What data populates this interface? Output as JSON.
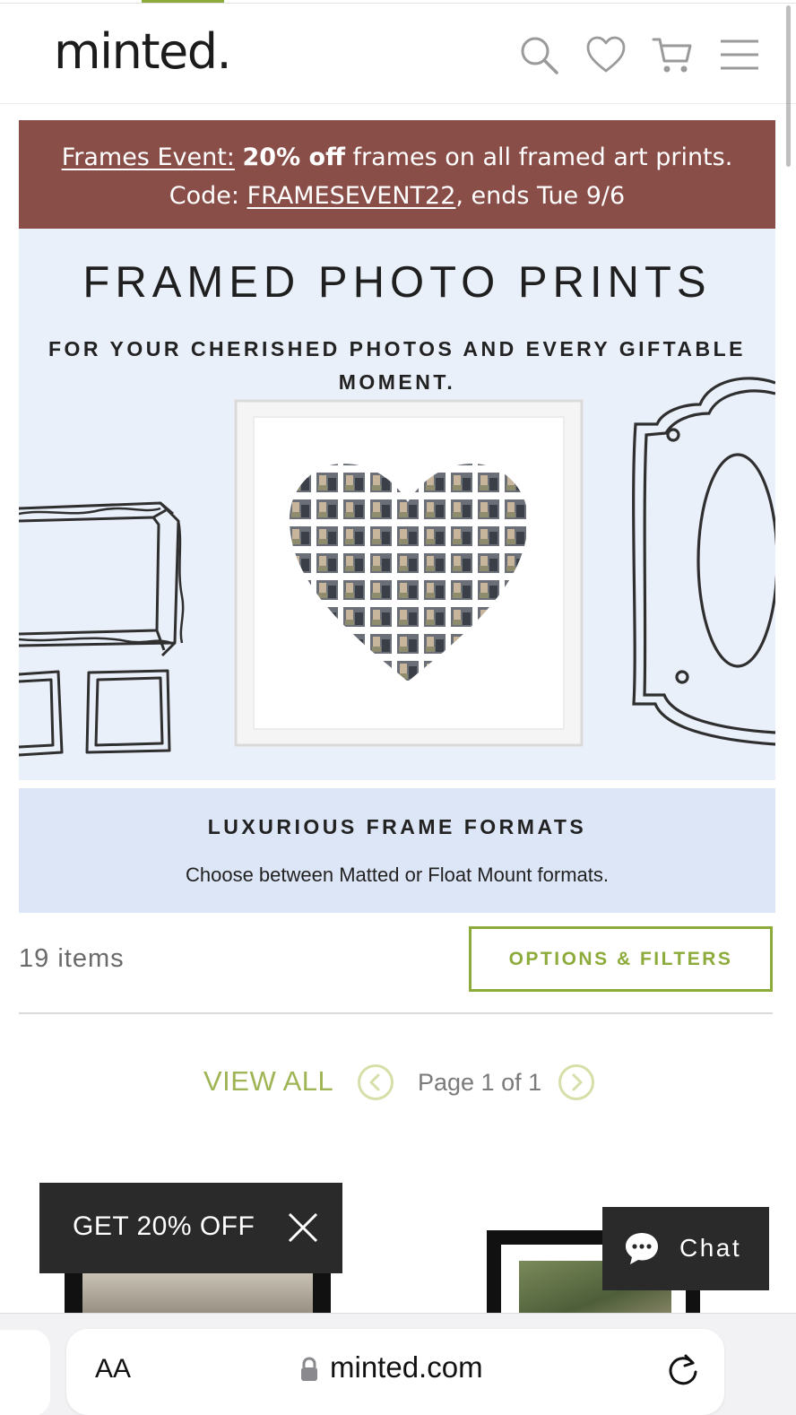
{
  "header": {
    "logo": "minted.",
    "icons": [
      "search-icon",
      "heart-icon",
      "cart-icon",
      "menu-icon"
    ]
  },
  "promo": {
    "event_link": "Frames Event:",
    "discount": "20% off",
    "line1_rest": "frames on all framed art prints.",
    "code_label": "Code:",
    "code": "FRAMESEVENT22",
    "ends": ", ends Tue 9/6"
  },
  "hero": {
    "title": "FRAMED PHOTO PRINTS",
    "subtitle": "FOR YOUR CHERISHED PHOTOS AND EVERY GIFTABLE MOMENT."
  },
  "formats": {
    "title": "LUXURIOUS FRAME FORMATS",
    "description": "Choose between Matted or Float Mount formats."
  },
  "results": {
    "count": "19 items",
    "filters_button": "OPTIONS & FILTERS"
  },
  "pagination": {
    "view_all": "VIEW ALL",
    "page_text": "Page 1 of 1"
  },
  "popups": {
    "discount": "GET 20% OFF",
    "chat": "Chat"
  },
  "browser": {
    "text_size": "AA",
    "url": "minted.com"
  },
  "colors": {
    "accent_green": "#8dab3a",
    "promo_bg": "#8a4e49",
    "hero_bg": "#eaf0fa",
    "formats_bg": "#dde6f6",
    "dark_popup": "#2a2a2a"
  }
}
